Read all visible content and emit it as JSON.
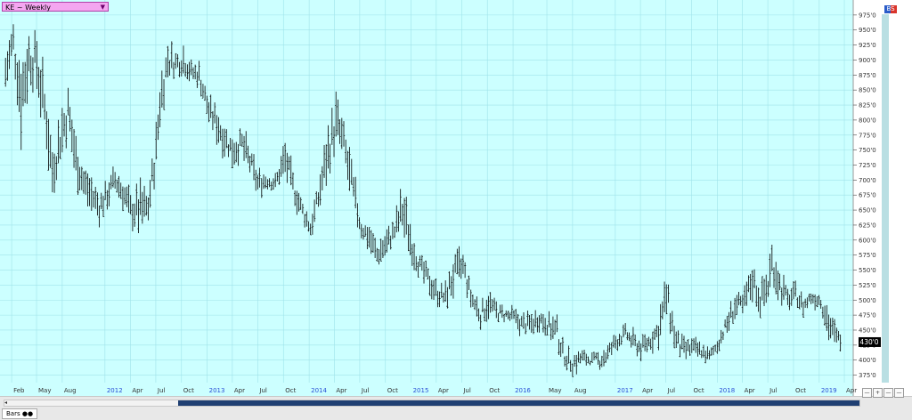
{
  "header": {
    "symbol_label": "KE ~ Weekly",
    "dropdown_arrow": "▼"
  },
  "corner_icon": {
    "label": "BS",
    "colors": [
      "#2a5cc9",
      "#d9342b"
    ]
  },
  "footer": {
    "tab_label": "Bars",
    "zoom_buttons": [
      "—",
      "+",
      "—",
      "—"
    ]
  },
  "colors": {
    "background": "#ccffff",
    "grid": "#9fe3ea",
    "bars": "#000000",
    "price_tag_bg": "#000000",
    "price_tag_fg": "#ffffff"
  },
  "chart_data": {
    "type": "ohlc",
    "grid": true,
    "ylim": [
      362.5,
      1000
    ],
    "y_ticks": [
      375,
      400,
      425,
      450,
      475,
      500,
      525,
      550,
      575,
      600,
      625,
      650,
      675,
      700,
      725,
      750,
      775,
      800,
      825,
      850,
      875,
      900,
      925,
      950,
      975
    ],
    "y_tick_labels": [
      "375'0",
      "400'0",
      "425'0",
      "450'0",
      "475'0",
      "500'0",
      "525'0",
      "550'0",
      "575'0",
      "600'0",
      "625'0",
      "650'0",
      "675'0",
      "700'0",
      "725'0",
      "750'0",
      "775'0",
      "800'0",
      "825'0",
      "850'0",
      "875'0",
      "900'0",
      "925'0",
      "950'0",
      "975'0"
    ],
    "x_labels": [
      {
        "label": "Feb",
        "date": "2011-02-01",
        "year": false
      },
      {
        "label": "May",
        "date": "2011-05-01",
        "year": false
      },
      {
        "label": "Aug",
        "date": "2011-08-01",
        "year": false
      },
      {
        "label": "2012",
        "date": "2012-01-01",
        "year": true
      },
      {
        "label": "Apr",
        "date": "2012-04-01",
        "year": false
      },
      {
        "label": "Jul",
        "date": "2012-07-01",
        "year": false
      },
      {
        "label": "Oct",
        "date": "2012-10-01",
        "year": false
      },
      {
        "label": "2013",
        "date": "2013-01-01",
        "year": true
      },
      {
        "label": "Apr",
        "date": "2013-04-01",
        "year": false
      },
      {
        "label": "Jul",
        "date": "2013-07-01",
        "year": false
      },
      {
        "label": "Oct",
        "date": "2013-10-01",
        "year": false
      },
      {
        "label": "2014",
        "date": "2014-01-01",
        "year": true
      },
      {
        "label": "Apr",
        "date": "2014-04-01",
        "year": false
      },
      {
        "label": "Jul",
        "date": "2014-07-01",
        "year": false
      },
      {
        "label": "Oct",
        "date": "2014-10-01",
        "year": false
      },
      {
        "label": "2015",
        "date": "2015-01-01",
        "year": true
      },
      {
        "label": "Apr",
        "date": "2015-04-01",
        "year": false
      },
      {
        "label": "Jul",
        "date": "2015-07-01",
        "year": false
      },
      {
        "label": "Oct",
        "date": "2015-10-01",
        "year": false
      },
      {
        "label": "2016",
        "date": "2016-01-01",
        "year": true
      },
      {
        "label": "May",
        "date": "2016-05-01",
        "year": false
      },
      {
        "label": "Aug",
        "date": "2016-08-01",
        "year": false
      },
      {
        "label": "2017",
        "date": "2017-01-01",
        "year": true
      },
      {
        "label": "Apr",
        "date": "2017-04-01",
        "year": false
      },
      {
        "label": "Jul",
        "date": "2017-07-01",
        "year": false
      },
      {
        "label": "Oct",
        "date": "2017-10-01",
        "year": false
      },
      {
        "label": "2018",
        "date": "2018-01-01",
        "year": true
      },
      {
        "label": "Apr",
        "date": "2018-04-01",
        "year": false
      },
      {
        "label": "Jul",
        "date": "2018-07-01",
        "year": false
      },
      {
        "label": "Oct",
        "date": "2018-10-01",
        "year": false
      },
      {
        "label": "2019",
        "date": "2019-01-01",
        "year": true
      },
      {
        "label": "Apr",
        "date": "2019-04-01",
        "year": false
      }
    ],
    "last_price": 430,
    "last_price_label": "430'0",
    "bars": [
      {
        "date": "2011-01-10",
        "high": 920,
        "low": 840
      },
      {
        "date": "2011-02-07",
        "high": 980,
        "low": 880
      },
      {
        "date": "2011-03-07",
        "high": 920,
        "low": 760
      },
      {
        "date": "2011-04-04",
        "high": 960,
        "low": 850
      },
      {
        "date": "2011-05-02",
        "high": 950,
        "low": 840
      },
      {
        "date": "2011-06-06",
        "high": 860,
        "low": 740
      },
      {
        "date": "2011-06-27",
        "high": 760,
        "low": 670
      },
      {
        "date": "2011-07-25",
        "high": 820,
        "low": 720
      },
      {
        "date": "2011-08-22",
        "high": 870,
        "low": 760
      },
      {
        "date": "2011-09-19",
        "high": 780,
        "low": 690
      },
      {
        "date": "2011-10-17",
        "high": 730,
        "low": 660
      },
      {
        "date": "2011-11-14",
        "high": 710,
        "low": 640
      },
      {
        "date": "2011-12-12",
        "high": 690,
        "low": 620
      },
      {
        "date": "2012-01-09",
        "high": 700,
        "low": 650
      },
      {
        "date": "2012-02-06",
        "high": 730,
        "low": 670
      },
      {
        "date": "2012-03-05",
        "high": 710,
        "low": 650
      },
      {
        "date": "2012-04-02",
        "high": 680,
        "low": 620
      },
      {
        "date": "2012-05-07",
        "high": 700,
        "low": 600
      },
      {
        "date": "2012-06-04",
        "high": 680,
        "low": 630
      },
      {
        "date": "2012-07-02",
        "high": 800,
        "low": 700
      },
      {
        "date": "2012-07-16",
        "high": 880,
        "low": 780
      },
      {
        "date": "2012-08-13",
        "high": 940,
        "low": 860
      },
      {
        "date": "2012-09-10",
        "high": 920,
        "low": 870
      },
      {
        "date": "2012-10-08",
        "high": 930,
        "low": 870
      },
      {
        "date": "2012-11-05",
        "high": 900,
        "low": 860
      },
      {
        "date": "2012-12-03",
        "high": 900,
        "low": 850
      },
      {
        "date": "2013-01-07",
        "high": 840,
        "low": 790
      },
      {
        "date": "2013-02-04",
        "high": 830,
        "low": 760
      },
      {
        "date": "2013-03-04",
        "high": 800,
        "low": 740
      },
      {
        "date": "2013-04-01",
        "high": 780,
        "low": 720
      },
      {
        "date": "2013-05-06",
        "high": 790,
        "low": 730
      },
      {
        "date": "2013-06-03",
        "high": 760,
        "low": 700
      },
      {
        "date": "2013-07-01",
        "high": 720,
        "low": 670
      },
      {
        "date": "2013-08-05",
        "high": 720,
        "low": 680
      },
      {
        "date": "2013-09-02",
        "high": 710,
        "low": 680
      },
      {
        "date": "2013-10-07",
        "high": 770,
        "low": 700
      },
      {
        "date": "2013-11-04",
        "high": 720,
        "low": 660
      },
      {
        "date": "2013-12-02",
        "high": 680,
        "low": 630
      },
      {
        "date": "2014-01-06",
        "high": 640,
        "low": 600
      },
      {
        "date": "2014-02-03",
        "high": 700,
        "low": 640
      },
      {
        "date": "2014-03-03",
        "high": 780,
        "low": 690
      },
      {
        "date": "2014-04-07",
        "high": 850,
        "low": 740
      },
      {
        "date": "2014-05-05",
        "high": 800,
        "low": 720
      },
      {
        "date": "2014-06-02",
        "high": 740,
        "low": 640
      },
      {
        "date": "2014-07-07",
        "high": 640,
        "low": 600
      },
      {
        "date": "2014-08-04",
        "high": 630,
        "low": 580
      },
      {
        "date": "2014-09-01",
        "high": 600,
        "low": 550
      },
      {
        "date": "2014-10-06",
        "high": 620,
        "low": 570
      },
      {
        "date": "2014-11-03",
        "high": 640,
        "low": 590
      },
      {
        "date": "2014-12-01",
        "high": 700,
        "low": 600
      },
      {
        "date": "2015-01-05",
        "high": 620,
        "low": 560
      },
      {
        "date": "2015-02-02",
        "high": 580,
        "low": 530
      },
      {
        "date": "2015-03-02",
        "high": 560,
        "low": 510
      },
      {
        "date": "2015-04-06",
        "high": 530,
        "low": 490
      },
      {
        "date": "2015-05-04",
        "high": 530,
        "low": 480
      },
      {
        "date": "2015-06-01",
        "high": 580,
        "low": 500
      },
      {
        "date": "2015-07-06",
        "high": 590,
        "low": 520
      },
      {
        "date": "2015-08-03",
        "high": 530,
        "low": 480
      },
      {
        "date": "2015-09-07",
        "high": 500,
        "low": 450
      },
      {
        "date": "2015-10-05",
        "high": 520,
        "low": 470
      },
      {
        "date": "2015-11-02",
        "high": 500,
        "low": 460
      },
      {
        "date": "2015-12-07",
        "high": 490,
        "low": 460
      },
      {
        "date": "2016-01-04",
        "high": 490,
        "low": 450
      },
      {
        "date": "2016-02-01",
        "high": 480,
        "low": 440
      },
      {
        "date": "2016-03-07",
        "high": 480,
        "low": 440
      },
      {
        "date": "2016-04-04",
        "high": 490,
        "low": 450
      },
      {
        "date": "2016-05-02",
        "high": 480,
        "low": 440
      },
      {
        "date": "2016-06-06",
        "high": 480,
        "low": 410
      },
      {
        "date": "2016-07-04",
        "high": 420,
        "low": 390
      },
      {
        "date": "2016-08-01",
        "high": 420,
        "low": 370
      },
      {
        "date": "2016-09-05",
        "high": 420,
        "low": 390
      },
      {
        "date": "2016-10-03",
        "high": 410,
        "low": 390
      },
      {
        "date": "2016-11-07",
        "high": 420,
        "low": 380
      },
      {
        "date": "2016-12-05",
        "high": 430,
        "low": 390
      },
      {
        "date": "2017-01-02",
        "high": 450,
        "low": 410
      },
      {
        "date": "2017-02-06",
        "high": 460,
        "low": 430
      },
      {
        "date": "2017-03-06",
        "high": 450,
        "low": 410
      },
      {
        "date": "2017-04-03",
        "high": 440,
        "low": 400
      },
      {
        "date": "2017-05-01",
        "high": 450,
        "low": 410
      },
      {
        "date": "2017-06-05",
        "high": 480,
        "low": 420
      },
      {
        "date": "2017-07-03",
        "high": 550,
        "low": 460
      },
      {
        "date": "2017-08-07",
        "high": 460,
        "low": 400
      },
      {
        "date": "2017-09-04",
        "high": 440,
        "low": 390
      },
      {
        "date": "2017-10-02",
        "high": 440,
        "low": 400
      },
      {
        "date": "2017-11-06",
        "high": 430,
        "low": 400
      },
      {
        "date": "2017-12-04",
        "high": 420,
        "low": 390
      },
      {
        "date": "2018-01-01",
        "high": 440,
        "low": 410
      },
      {
        "date": "2018-02-05",
        "high": 480,
        "low": 440
      },
      {
        "date": "2018-03-05",
        "high": 520,
        "low": 460
      },
      {
        "date": "2018-04-02",
        "high": 510,
        "low": 470
      },
      {
        "date": "2018-05-07",
        "high": 570,
        "low": 500
      },
      {
        "date": "2018-06-04",
        "high": 530,
        "low": 470
      },
      {
        "date": "2018-07-02",
        "high": 560,
        "low": 490
      },
      {
        "date": "2018-07-16",
        "high": 600,
        "low": 530
      },
      {
        "date": "2018-08-13",
        "high": 560,
        "low": 490
      },
      {
        "date": "2018-09-10",
        "high": 520,
        "low": 480
      },
      {
        "date": "2018-10-08",
        "high": 530,
        "low": 490
      },
      {
        "date": "2018-11-05",
        "high": 510,
        "low": 470
      },
      {
        "date": "2018-12-03",
        "high": 520,
        "low": 490
      },
      {
        "date": "2019-01-07",
        "high": 520,
        "low": 480
      },
      {
        "date": "2019-02-04",
        "high": 490,
        "low": 430
      },
      {
        "date": "2019-03-04",
        "high": 460,
        "low": 410
      },
      {
        "date": "2019-03-25",
        "high": 450,
        "low": 420
      }
    ]
  }
}
